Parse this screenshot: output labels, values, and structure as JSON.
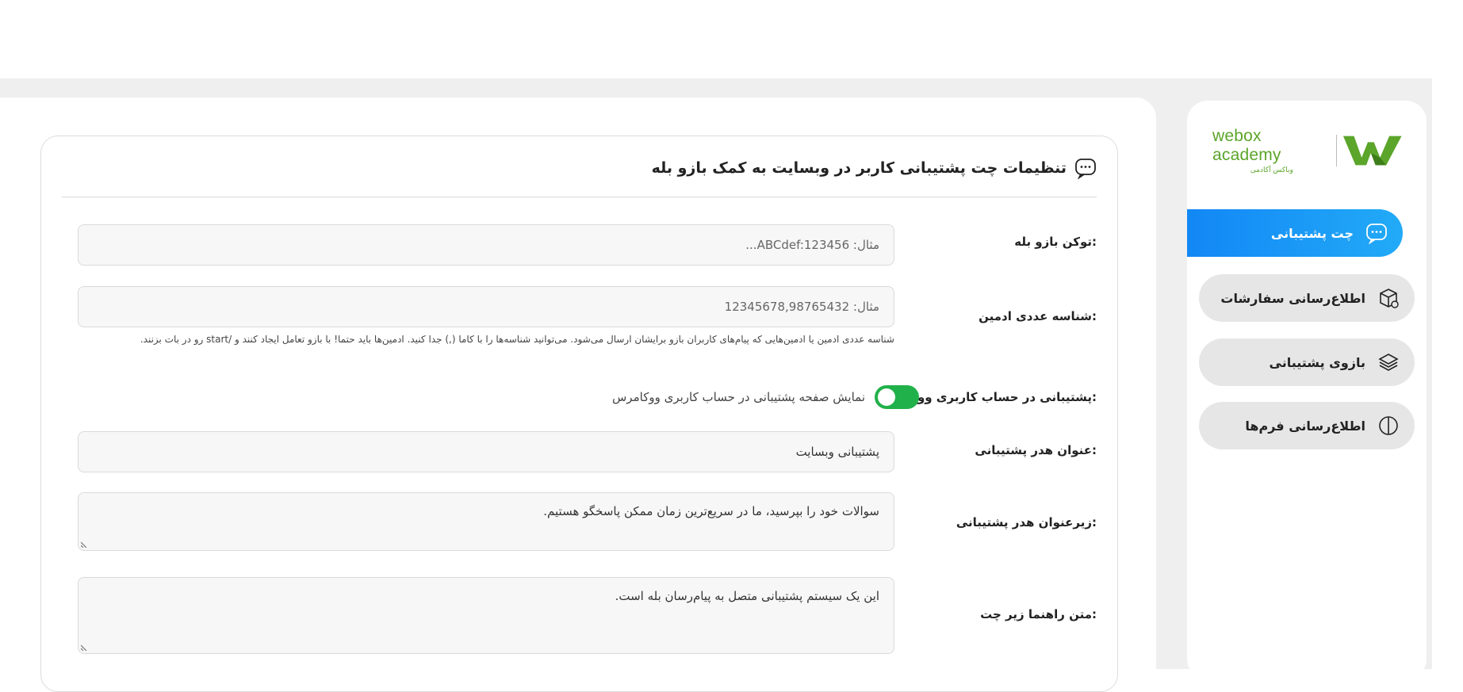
{
  "brand": {
    "name": "webox academy",
    "subtitle": "وباکس آکادمی",
    "accent": "#5ba52a"
  },
  "sidebar": {
    "items": [
      {
        "label": "چت پشتیبانی",
        "icon": "chat-bubble-icon",
        "active": true
      },
      {
        "label": "اطلاع‌رسانی سفارشات",
        "icon": "box-icon",
        "active": false
      },
      {
        "label": "بازوی پشتیبانی",
        "icon": "layers-icon",
        "active": false
      },
      {
        "label": "اطلاع‌رسانی فرم‌ها",
        "icon": "half-circle-icon",
        "active": false
      }
    ]
  },
  "card": {
    "title": "تنظیمات چت پشتیبانی کاربر در وبسایت به کمک بازو بله",
    "title_icon": "chat-bubble-icon",
    "fields": {
      "token": {
        "label": "توکن بازو بله:",
        "placeholder": "مثال: ABCdef:123456..."
      },
      "admin_id": {
        "label": "شناسه عددی ادمین:",
        "placeholder": "مثال: 12345678,98765432",
        "hint": "شناسه عددی ادمین یا ادمین‌هایی که پیام‌های کاربران بازو برایشان ارسال می‌شود. می‌توانید شناسه‌ها را با کاما (,) جدا کنید. ادمین‌ها باید حتما! با بازو تعامل ایجاد کنند و /start رو در بات بزنند."
      },
      "woocommerce": {
        "label": "پشتیبانی در حساب کاربری ووکامرس:",
        "toggle_text": "نمایش صفحه پشتیبانی در حساب کاربری ووکامرس",
        "enabled": true,
        "toggle_color": "#21b14a"
      },
      "header_title": {
        "label": "عنوان هدر پشتیبانی:",
        "value": "پشتیبانی وبسایت"
      },
      "header_subtitle": {
        "label": "زیرعنوان هدر پشتیبانی:",
        "value": "سوالات خود را بپرسید، ما در سریع‌ترین زمان ممکن پاسخگو هستیم."
      },
      "guide_text": {
        "label": "متن راهنما زیر چت:",
        "value": "این یک سیستم پشتیبانی متصل به پیام‌رسان بله است."
      }
    }
  },
  "colors": {
    "active_nav_start": "#1287f5",
    "active_nav_end": "#22aaf7",
    "background": "#efefef"
  }
}
